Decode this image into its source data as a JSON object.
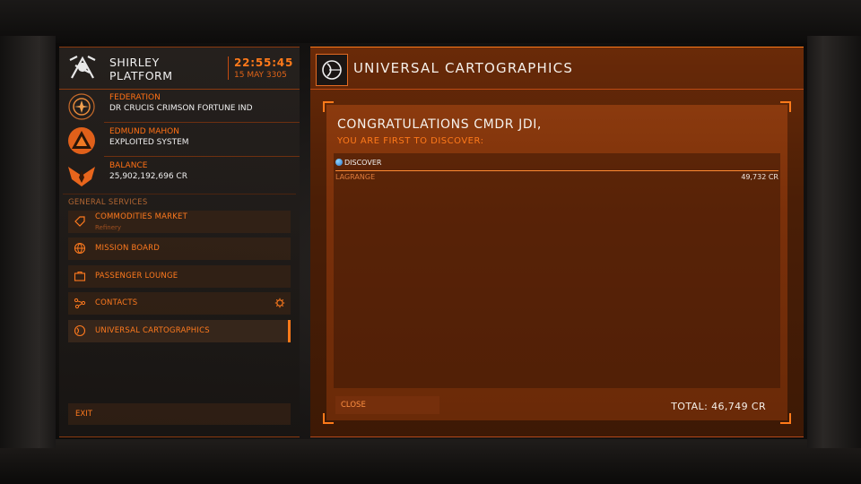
{
  "station": {
    "name_line1": "SHIRLEY",
    "name_line2": "PLATFORM",
    "time": "22:55:45",
    "date": "15 MAY 3305"
  },
  "info": {
    "faction_label": "FEDERATION",
    "faction_value": "DR CRUCIS CRIMSON FORTUNE IND",
    "power_label": "EDMUND MAHON",
    "power_value": "EXPLOITED SYSTEM",
    "balance_label": "BALANCE",
    "balance_value": "25,902,192,696 CR"
  },
  "services": {
    "title": "GENERAL SERVICES",
    "items": [
      {
        "label": "COMMODITIES MARKET",
        "sub": "Refinery",
        "icon": "tag-icon"
      },
      {
        "label": "MISSION BOARD",
        "icon": "globe-icon"
      },
      {
        "label": "PASSENGER LOUNGE",
        "icon": "briefcase-icon"
      },
      {
        "label": "CONTACTS",
        "icon": "nodes-icon",
        "trailing_icon": "gear-icon"
      },
      {
        "label": "UNIVERSAL CARTOGRAPHICS",
        "icon": "cartographics-icon",
        "active": true
      }
    ],
    "exit_label": "EXIT"
  },
  "cartographics": {
    "title": "UNIVERSAL CARTOGRAPHICS",
    "congrats": "CONGRATULATIONS CMDR JDI,",
    "subtitle": "YOU ARE FIRST TO DISCOVER:",
    "column_header": "DISCOVER",
    "rows": [
      {
        "name": "LAGRANGE",
        "value": "49,732 CR"
      }
    ],
    "close_label": "CLOSE",
    "total": "TOTAL: 46,749 CR"
  },
  "colors": {
    "accent": "#ff7a1a",
    "panel": "#7a300a"
  }
}
